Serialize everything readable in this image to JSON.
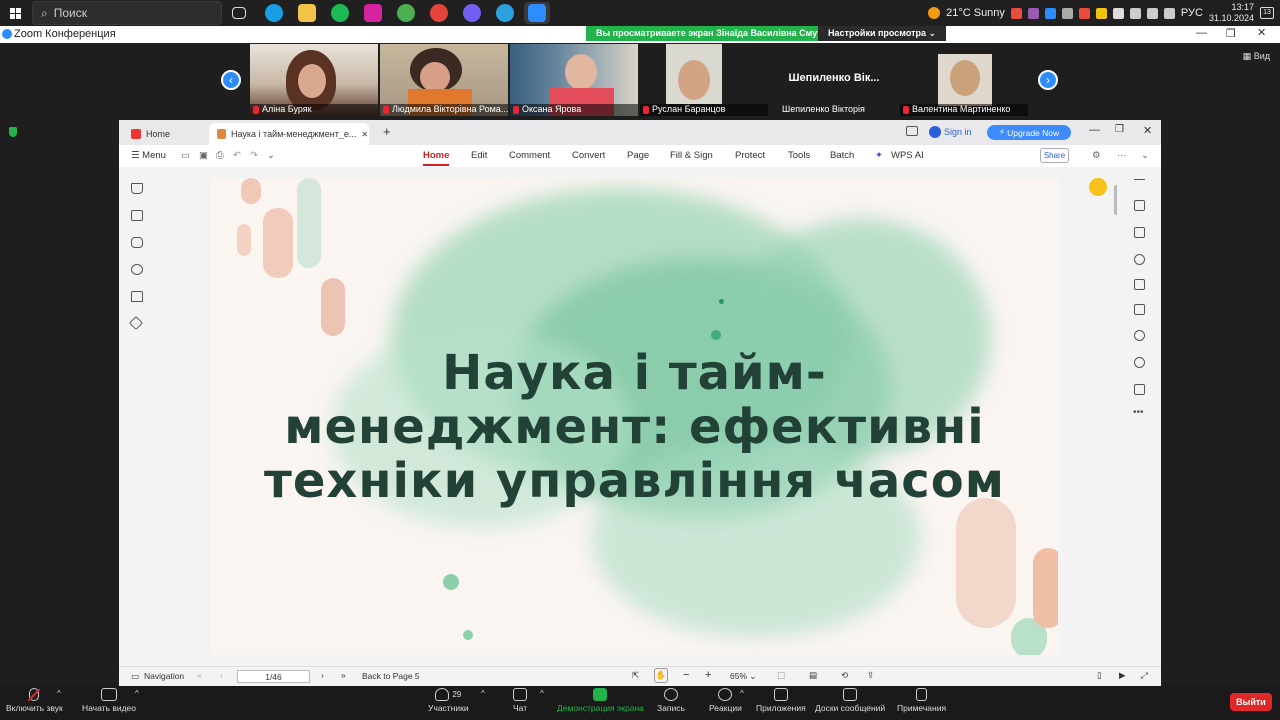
{
  "taskbar": {
    "search_placeholder": "Поиск",
    "weather": "21°C  Sunny",
    "lang": "РУС",
    "time": "13:17",
    "date": "31.10.2024",
    "notif_count": "13"
  },
  "zoom": {
    "window_title": "Zoom Конференция",
    "share_banner": "Вы просматриваете экран Зінаїда Василівна Смутчак",
    "view_settings": "Настройки просмотра",
    "view_button": "Вид",
    "participants": [
      {
        "name": "Аліна Буряк",
        "video": true
      },
      {
        "name": "Людмила Вікторівна Рома...",
        "video": true
      },
      {
        "name": "Оксана Ярова",
        "video": true
      },
      {
        "name": "Руслан Баранцов",
        "video": true
      },
      {
        "name": "Шепиленко Вікторія",
        "video": false,
        "display": "Шепиленко  Вік..."
      },
      {
        "name": "Валентина Мартиненко",
        "video": true
      }
    ],
    "controls": {
      "audio": "Включить звук",
      "video": "Начать видео",
      "participants": "Участники",
      "participants_count": "29",
      "chat": "Чат",
      "share": "Демонстрация экрана",
      "record": "Запись",
      "reactions": "Реакции",
      "apps": "Приложения",
      "whiteboards": "Доски сообщений",
      "notes": "Примечания",
      "leave": "Выйти"
    }
  },
  "wps": {
    "tabs": {
      "home": "Home",
      "doc": "Наука і тайм-менеджмент_е..."
    },
    "sign_in": "Sign in",
    "upgrade": "Upgrade Now",
    "menu": {
      "menu_label": "Menu",
      "items": [
        "Home",
        "Edit",
        "Comment",
        "Convert",
        "Page",
        "Fill & Sign",
        "Protect",
        "Tools",
        "Batch",
        "WPS AI"
      ],
      "share": "Share"
    },
    "slide": {
      "title_line1": "Наука і тайм-",
      "title_line2": "менеджмент:  ефективні",
      "title_line3": "техніки управління часом"
    },
    "status": {
      "navigation": "Navigation",
      "page": "1/46",
      "back_to_page": "Back to Page 5",
      "zoom": "65%"
    }
  }
}
